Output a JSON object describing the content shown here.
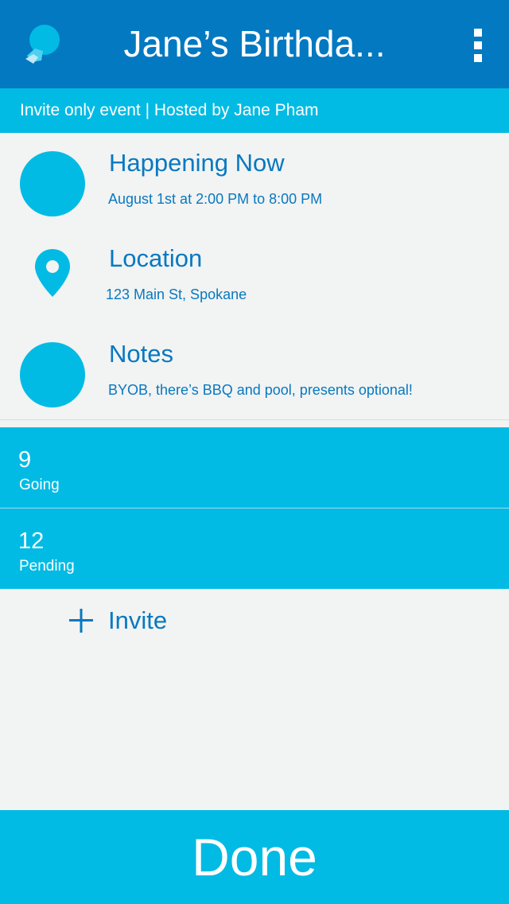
{
  "header": {
    "title": "Jane’s Birthda...",
    "logo_icon": "app-logo-icon",
    "menu_icon": "more-vertical-icon",
    "background": "#0279c1"
  },
  "subheader": {
    "text": "Invite only event | Hosted by Jane Pham",
    "background": "#01bbe4"
  },
  "details": [
    {
      "label": "Happening Now",
      "detail": "August 1st at 2:00 PM to 8:00 PM",
      "icon": "time-circle-icon"
    },
    {
      "label": "Location",
      "detail": "123 Main St, Spokane",
      "icon": "location-pin-icon"
    },
    {
      "label": "Notes",
      "detail": "BYOB, there’s BBQ and pool, presents optional!",
      "icon": "notes-circle-icon"
    }
  ],
  "stats": [
    {
      "count": "9",
      "label": "Going"
    },
    {
      "count": "12",
      "label": "Pending"
    }
  ],
  "invite": {
    "label": "Invite",
    "icon": "plus-icon"
  },
  "footer": {
    "done_label": "Done"
  },
  "colors": {
    "accent": "#01bbe4",
    "primary": "#0279c1",
    "text_blue": "#0779c0",
    "background": "#f2f3f3"
  }
}
